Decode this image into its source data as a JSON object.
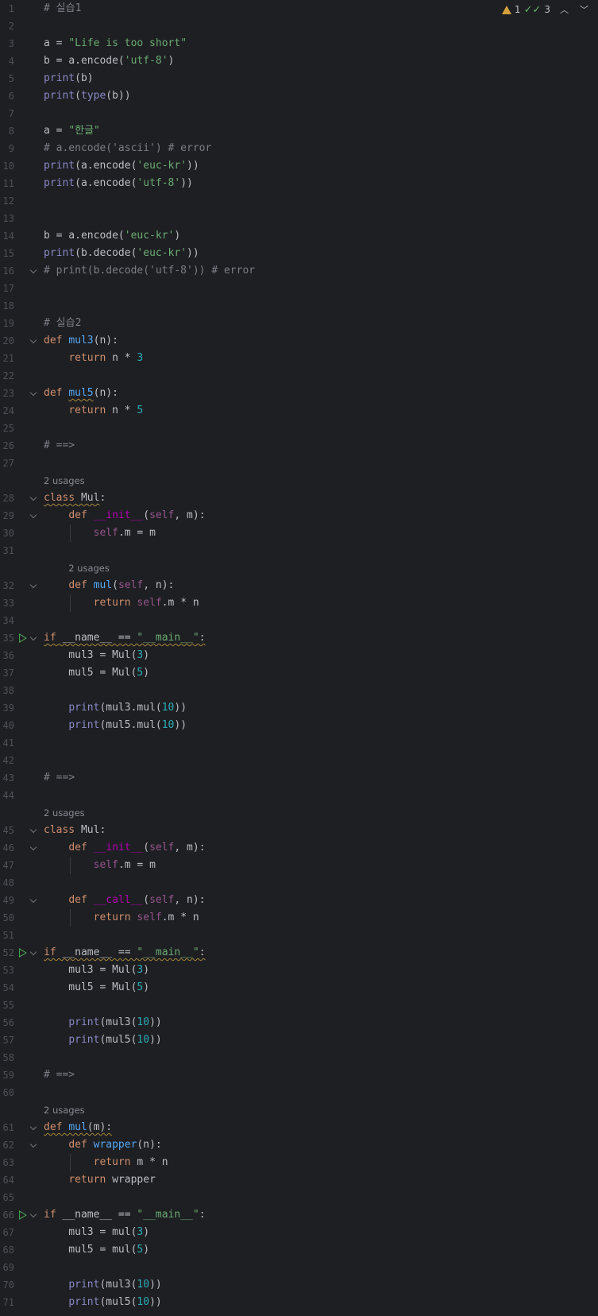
{
  "status": {
    "warnings": "1",
    "checks": "3"
  },
  "lines": [
    {
      "n": "1",
      "t": "# 실습1"
    },
    {
      "n": "2",
      "t": ""
    },
    {
      "n": "3",
      "t": "a = \"Life is too short\""
    },
    {
      "n": "4",
      "t": "b = a.encode('utf-8')"
    },
    {
      "n": "5",
      "t": "print(b)"
    },
    {
      "n": "6",
      "t": "print(type(b))"
    },
    {
      "n": "7",
      "t": ""
    },
    {
      "n": "8",
      "t": "a = \"한글\""
    },
    {
      "n": "9",
      "t": "# a.encode('ascii') # error"
    },
    {
      "n": "10",
      "t": "print(a.encode('euc-kr'))"
    },
    {
      "n": "11",
      "t": "print(a.encode('utf-8'))"
    },
    {
      "n": "12",
      "t": ""
    },
    {
      "n": "13",
      "t": ""
    },
    {
      "n": "14",
      "t": "b = a.encode('euc-kr')"
    },
    {
      "n": "15",
      "t": "print(b.decode('euc-kr'))"
    },
    {
      "n": "16",
      "t": "# print(b.decode('utf-8')) # error"
    },
    {
      "n": "17",
      "t": ""
    },
    {
      "n": "18",
      "t": ""
    },
    {
      "n": "19",
      "t": "# 실습2"
    },
    {
      "n": "20",
      "t": "def mul3(n):"
    },
    {
      "n": "21",
      "t": "    return n * 3"
    },
    {
      "n": "22",
      "t": ""
    },
    {
      "n": "23",
      "t": "def mul5(n):"
    },
    {
      "n": "24",
      "t": "    return n * 5"
    },
    {
      "n": "25",
      "t": ""
    },
    {
      "n": "26",
      "t": "# ==>"
    },
    {
      "n": "27",
      "t": ""
    },
    {
      "hint": "2 usages"
    },
    {
      "n": "28",
      "t": "class Mul:"
    },
    {
      "n": "29",
      "t": "    def __init__(self, m):"
    },
    {
      "n": "30",
      "t": "        self.m = m"
    },
    {
      "n": "31",
      "t": ""
    },
    {
      "hint": "2 usages"
    },
    {
      "n": "32",
      "t": "    def mul(self, n):"
    },
    {
      "n": "33",
      "t": "        return self.m * n"
    },
    {
      "n": "34",
      "t": ""
    },
    {
      "n": "35",
      "t": "if __name__ == \"__main__\":"
    },
    {
      "n": "36",
      "t": "    mul3 = Mul(3)"
    },
    {
      "n": "37",
      "t": "    mul5 = Mul(5)"
    },
    {
      "n": "38",
      "t": ""
    },
    {
      "n": "39",
      "t": "    print(mul3.mul(10))"
    },
    {
      "n": "40",
      "t": "    print(mul5.mul(10))"
    },
    {
      "n": "41",
      "t": ""
    },
    {
      "n": "42",
      "t": ""
    },
    {
      "n": "43",
      "t": "# ==>"
    },
    {
      "n": "44",
      "t": ""
    },
    {
      "hint": "2 usages"
    },
    {
      "n": "45",
      "t": "class Mul:"
    },
    {
      "n": "46",
      "t": "    def __init__(self, m):"
    },
    {
      "n": "47",
      "t": "        self.m = m"
    },
    {
      "n": "48",
      "t": ""
    },
    {
      "n": "49",
      "t": "    def __call__(self, n):"
    },
    {
      "n": "50",
      "t": "        return self.m * n"
    },
    {
      "n": "51",
      "t": ""
    },
    {
      "n": "52",
      "t": "if __name__ == \"__main__\":"
    },
    {
      "n": "53",
      "t": "    mul3 = Mul(3)"
    },
    {
      "n": "54",
      "t": "    mul5 = Mul(5)"
    },
    {
      "n": "55",
      "t": ""
    },
    {
      "n": "56",
      "t": "    print(mul3(10))"
    },
    {
      "n": "57",
      "t": "    print(mul5(10))"
    },
    {
      "n": "58",
      "t": ""
    },
    {
      "n": "59",
      "t": "# ==>"
    },
    {
      "n": "60",
      "t": ""
    },
    {
      "hint": "2 usages"
    },
    {
      "n": "61",
      "t": "def mul(m):"
    },
    {
      "n": "62",
      "t": "    def wrapper(n):"
    },
    {
      "n": "63",
      "t": "        return m * n"
    },
    {
      "n": "64",
      "t": "    return wrapper"
    },
    {
      "n": "65",
      "t": ""
    },
    {
      "n": "66",
      "t": "if __name__ == \"__main__\":"
    },
    {
      "n": "67",
      "t": "    mul3 = mul(3)"
    },
    {
      "n": "68",
      "t": "    mul5 = mul(5)"
    },
    {
      "n": "69",
      "t": ""
    },
    {
      "n": "70",
      "t": "    print(mul3(10))"
    },
    {
      "n": "71",
      "t": "    print(mul5(10))"
    }
  ]
}
